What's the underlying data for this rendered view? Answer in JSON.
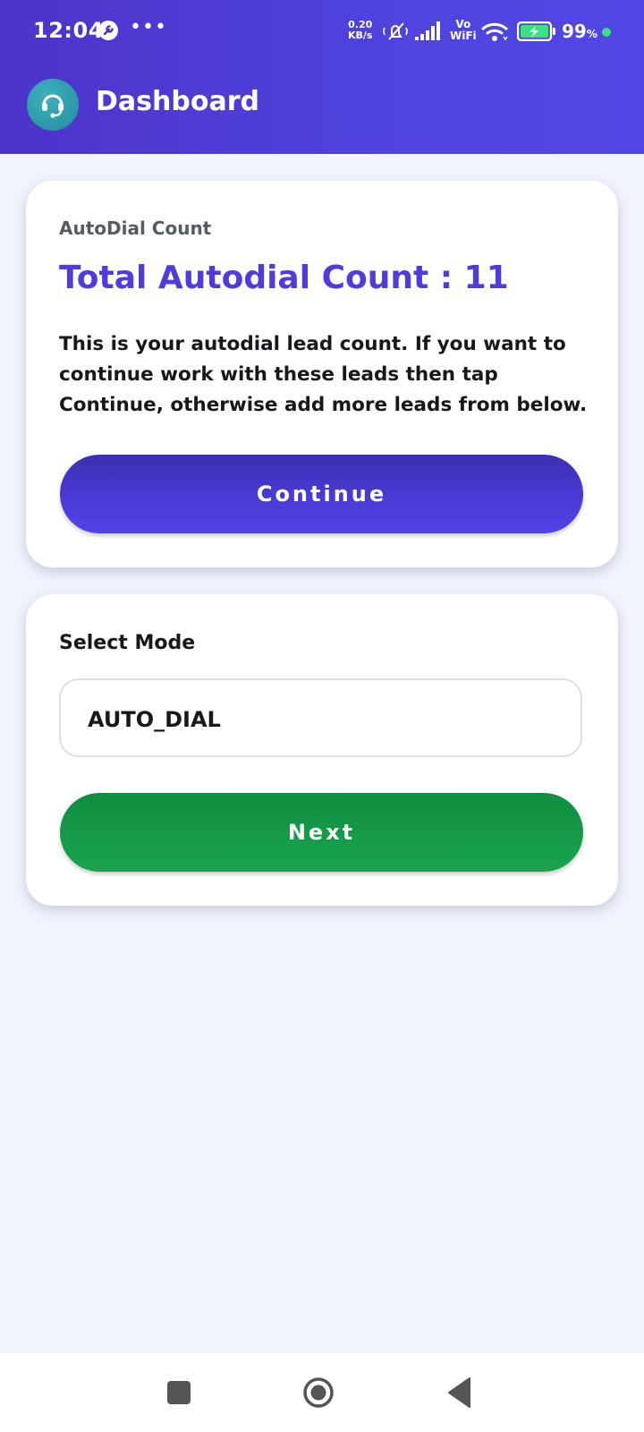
{
  "status_bar": {
    "time": "12:04",
    "net_speed_value": "0.20",
    "net_speed_unit": "KB/s",
    "vowifi_top": "Vo",
    "vowifi_bottom": "WiFi",
    "battery_percent": "99",
    "battery_unit": "%",
    "icons": [
      "wrench-icon",
      "more-icon",
      "mute-icon",
      "signal-icon",
      "wifi-icon",
      "battery-charging-icon"
    ]
  },
  "app_bar": {
    "title": "Dashboard",
    "avatar_icon": "headset-icon"
  },
  "autodial_card": {
    "subtitle": "AutoDial Count",
    "heading": "Total Autodial Count : 11",
    "description": "This is your autodial lead count. If you want to continue work with these leads then tap Continue, otherwise add more leads from below.",
    "continue_label": "Continue"
  },
  "mode_card": {
    "label": "Select Mode",
    "selected_mode": "AUTO_DIAL",
    "next_label": "Next"
  },
  "nav_bar": {
    "icons": [
      "recents-icon",
      "home-icon",
      "back-icon"
    ]
  },
  "colors": {
    "primary": "#4f3ddb",
    "header": "#4f42dc",
    "success": "#169a48",
    "background": "#f1f4fd"
  }
}
